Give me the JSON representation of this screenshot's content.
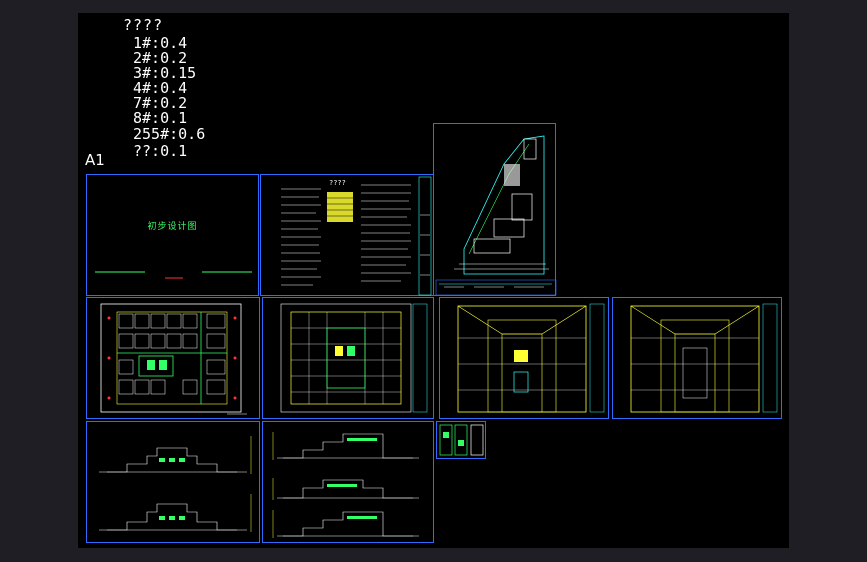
{
  "legend": {
    "title": "????",
    "items": [
      "1#:0.4",
      "2#:0.2",
      "3#:0.15",
      "4#:0.4",
      "7#:0.2",
      "8#:0.1",
      "255#:0.6",
      "??:0.1"
    ]
  },
  "paper_size_label": "A1",
  "sheets": {
    "cover": {
      "title": "初步设计图"
    },
    "notes": {
      "title": "????"
    }
  },
  "colors": {
    "background": "#000000",
    "viewport_frame": "#1e1e24",
    "sheet_border": "#2e6bff",
    "linework_primary": "#ffff33",
    "linework_secondary": "#33ff66",
    "linework_tertiary": "#33ffff",
    "text": "#ffffff"
  }
}
